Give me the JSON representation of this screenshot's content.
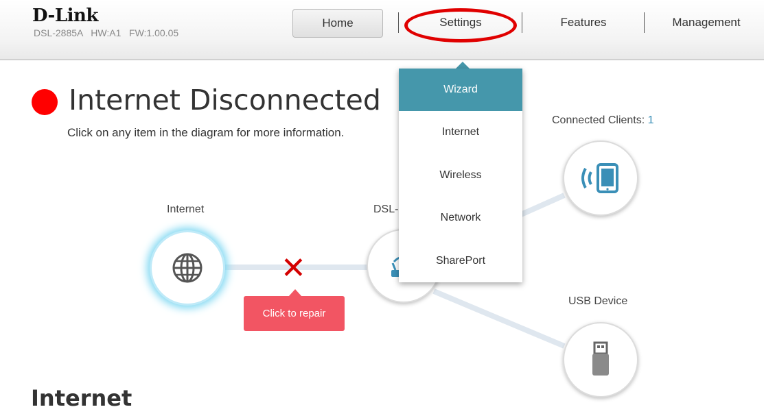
{
  "brand": {
    "logo": "D-Link",
    "model_info": "DSL-2885A   HW:A1   FW:1.00.05"
  },
  "nav": {
    "home": "Home",
    "settings": "Settings",
    "features": "Features",
    "management": "Management"
  },
  "status": {
    "title": "Internet Disconnected",
    "subtitle": "Click on any item in the diagram for more information.",
    "color": "#ff0000"
  },
  "diagram": {
    "internet_label": "Internet",
    "router_label": "DSL-",
    "clients_label": "Connected Clients: ",
    "clients_count": "1",
    "usb_label": "USB Device",
    "repair_label": "Click to repair",
    "icons": [
      "globe-icon",
      "router-icon",
      "wireless-tablet-icon",
      "usb-drive-icon",
      "x-mark-icon"
    ]
  },
  "settings_menu": {
    "items": [
      "Wizard",
      "Internet",
      "Wireless",
      "Network",
      "SharePort"
    ],
    "active": "Wizard"
  },
  "section": {
    "title": "Internet"
  },
  "colors": {
    "accent": "#4597ab",
    "repair": "#f25563",
    "error": "#d40000",
    "link": "#3a8fb7"
  }
}
